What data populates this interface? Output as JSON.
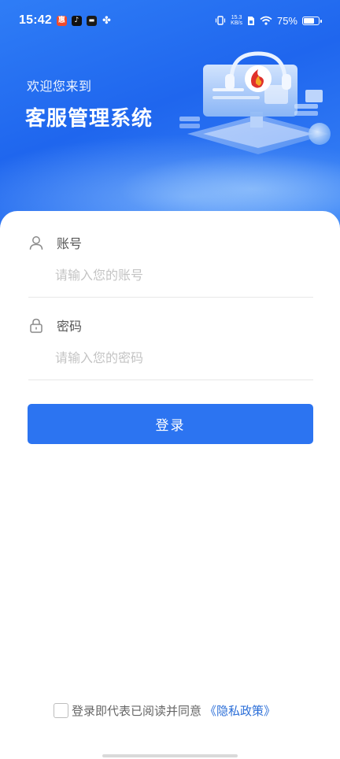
{
  "status_bar": {
    "time": "15:42",
    "network_speed_value": "15.3",
    "network_speed_unit": "KB/s",
    "battery_percent": "75%"
  },
  "hero": {
    "welcome_text": "欢迎您来到",
    "system_title": "客服管理系统"
  },
  "form": {
    "account": {
      "label": "账号",
      "placeholder": "请输入您的账号",
      "value": ""
    },
    "password": {
      "label": "密码",
      "placeholder": "请输入您的密码",
      "value": ""
    },
    "login_label": "登录"
  },
  "agreement": {
    "checked": false,
    "text": "登录即代表已阅读并同意",
    "policy_link": "《隐私政策》"
  },
  "colors": {
    "primary": "#2c74f1",
    "hero_gradient_start": "#2f7df6",
    "hero_gradient_end": "#3b86f7",
    "link": "#2c6fd8"
  }
}
